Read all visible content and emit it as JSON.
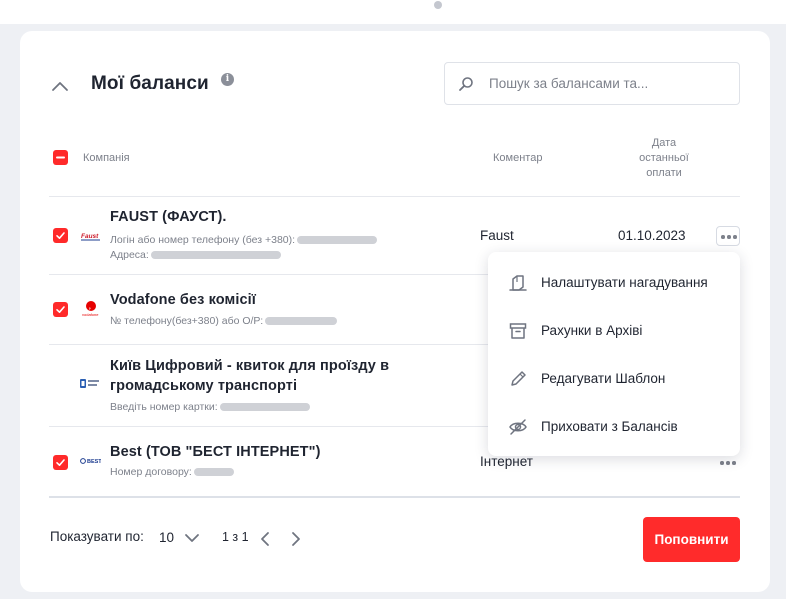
{
  "header": {
    "title": "Мої баланси",
    "info_glyph": "i",
    "search_placeholder": "Пошук за балансами та..."
  },
  "table": {
    "columns": {
      "company": "Компанія",
      "comment": "Коментар",
      "last_payment": [
        "Дата",
        "останньої",
        "оплати"
      ]
    },
    "rows": [
      {
        "name": "FAUST (ФАУСТ).",
        "field1": "Логін або номер телефону (без +380):",
        "field2": "Адреса:",
        "comment": "Faust",
        "date": "01.10.2023",
        "logo": "faust-logo"
      },
      {
        "name": "Vodafone без комісії",
        "field1": "№ телефону(без+380) або О/Р:",
        "comment": "",
        "date": "",
        "logo": "vodafone-logo"
      },
      {
        "name_line1": "Київ Цифровий - квиток для проїзду в",
        "name_line2": "громадському транспорті",
        "field1": "Введіть номер картки:",
        "comment": "",
        "date": "",
        "logo": "kyiv-digital-logo"
      },
      {
        "name": "Best (ТОВ \"БЕСТ ІНТЕРНЕТ\")",
        "field1": "Номер договору:",
        "comment": "Інтернет",
        "date": "",
        "logo": "best-logo"
      }
    ]
  },
  "context_menu": {
    "items": [
      {
        "label": "Налаштувати нагадування",
        "icon": "reminder-icon"
      },
      {
        "label": "Рахунки в Архіві",
        "icon": "archive-icon"
      },
      {
        "label": "Редагувати Шаблон",
        "icon": "edit-icon"
      },
      {
        "label": "Приховати з Балансів",
        "icon": "hide-icon"
      }
    ]
  },
  "pager": {
    "show_label": "Показувати по:",
    "page_size": "10",
    "pages": "1 з 1"
  },
  "actions": {
    "topup_label": "Поповнити"
  },
  "colors": {
    "accent": "#ff2a2a",
    "text": "#1f2430",
    "muted": "#7d818b"
  }
}
